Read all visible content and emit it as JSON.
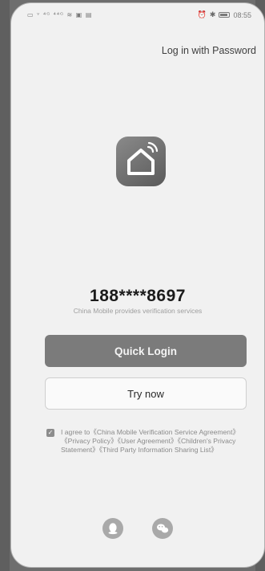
{
  "status_bar": {
    "left_icons_text": "▭ ᵛ ⁴ᴳ ⁴⁴ᴳ ≋ ▣ ▤",
    "right_icons": [
      "alarm-icon",
      "bluetooth-icon",
      "battery-icon"
    ],
    "time": "08:55"
  },
  "header": {
    "password_login_label": "Log in with Password"
  },
  "login": {
    "phone_number": "188****8697",
    "carrier_note": "China Mobile provides verification services",
    "quick_login_label": "Quick Login",
    "try_now_label": "Try now"
  },
  "agreement": {
    "text": "I agree to《China Mobile Verification Service Agreement》《Privacy Policy》《User Agreement》《Children's Privacy Statement》《Third Party Information Sharing List》"
  },
  "colors": {
    "primary_button": "#7b7b7b",
    "background": "#f1f1f1"
  },
  "bottom_login_icons": [
    "qq-icon",
    "wechat-icon"
  ]
}
